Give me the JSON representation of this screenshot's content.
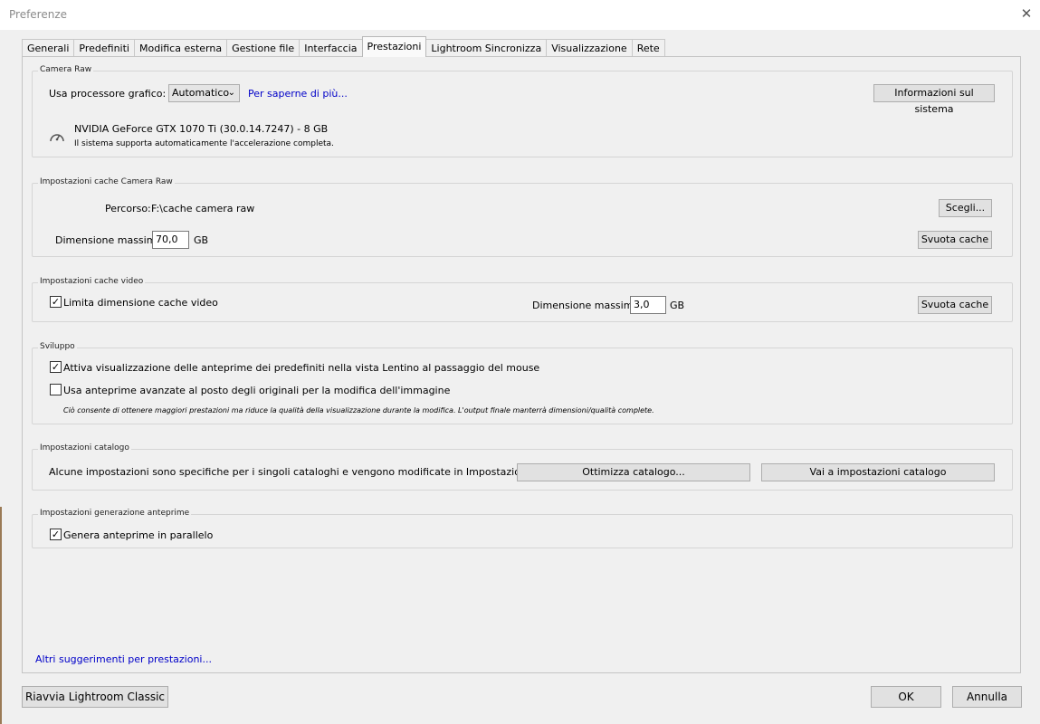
{
  "window": {
    "title": "Preferenze",
    "close_glyph": "✕"
  },
  "tabs": [
    {
      "label": "Generali",
      "active": false
    },
    {
      "label": "Predefiniti",
      "active": false
    },
    {
      "label": "Modifica esterna",
      "active": false
    },
    {
      "label": "Gestione file",
      "active": false
    },
    {
      "label": "Interfaccia",
      "active": false
    },
    {
      "label": "Prestazioni",
      "active": true
    },
    {
      "label": "Lightroom Sincronizza",
      "active": false
    },
    {
      "label": "Visualizzazione",
      "active": false
    },
    {
      "label": "Rete",
      "active": false
    }
  ],
  "camera_raw": {
    "group_label": "Camera Raw",
    "gpu_label": "Usa processore grafico:",
    "gpu_value": "Automatico",
    "learn_more": "Per saperne di più...",
    "system_info_button": "Informazioni sul sistema",
    "gpu_name": "NVIDIA GeForce GTX 1070 Ti (30.0.14.7247) - 8 GB",
    "gpu_status": "Il sistema supporta automaticamente l'accelerazione completa."
  },
  "cache_camera_raw": {
    "group_label": "Impostazioni cache Camera Raw",
    "path_label": "Percorso:",
    "path_value": "F:\\cache camera raw",
    "choose_button": "Scegli...",
    "max_size_label": "Dimensione massima:",
    "max_size_value": "70,0",
    "unit": "GB",
    "purge_button": "Svuota cache"
  },
  "cache_video": {
    "group_label": "Impostazioni cache video",
    "limit_label": "Limita dimensione cache video",
    "limit_checked": true,
    "max_size_label": "Dimensione massima:",
    "max_size_value": "3,0",
    "unit": "GB",
    "purge_button": "Svuota cache"
  },
  "develop": {
    "group_label": "Sviluppo",
    "hover_preview_label": "Attiva visualizzazione delle anteprime dei predefiniti nella vista Lentino al passaggio del mouse",
    "hover_preview_checked": true,
    "smart_preview_label": "Usa anteprime avanzate al posto degli originali per la modifica dell'immagine",
    "smart_preview_checked": false,
    "note": "Ciò consente di ottenere maggiori prestazioni ma riduce la qualità della visualizzazione durante la modifica. L'output finale manterrà dimensioni/qualità complete."
  },
  "catalog": {
    "group_label": "Impostazioni catalogo",
    "description": "Alcune impostazioni sono specifiche per i singoli cataloghi e vengono modificate in Impostazioni catalogo.",
    "optimize_button": "Ottimizza catalogo...",
    "goto_button": "Vai a impostazioni catalogo"
  },
  "preview_generation": {
    "group_label": "Impostazioni generazione anteprime",
    "parallel_label": "Genera anteprime in parallelo",
    "parallel_checked": true
  },
  "more_tips": "Altri suggerimenti per prestazioni...",
  "footer": {
    "restart_button": "Riavvia Lightroom Classic",
    "ok_button": "OK",
    "cancel_button": "Annulla"
  },
  "check_glyph": "✓"
}
